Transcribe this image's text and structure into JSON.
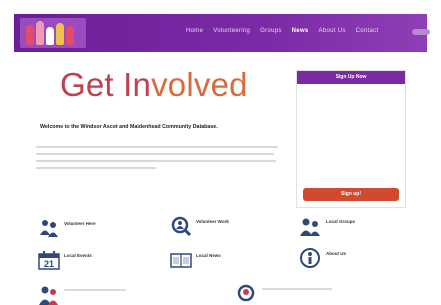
{
  "header": {
    "nav": [
      {
        "label": "Home",
        "active": false
      },
      {
        "label": "Volunteering",
        "active": false
      },
      {
        "label": "Groups",
        "active": false
      },
      {
        "label": "News",
        "active": true
      },
      {
        "label": "About Us",
        "active": false
      },
      {
        "label": "Contact",
        "active": false
      }
    ]
  },
  "main": {
    "title": "Get Involved",
    "welcome": "Welcome to the Windsor Ascot and Maidenhead Community Database."
  },
  "signup": {
    "header": "Sign Up Now",
    "button": "Sign up!"
  },
  "tiles": {
    "volunteer_here": "Volunteer Here",
    "volunteer_work": "Volunteer Work",
    "local_groups": "Local Groups",
    "local_events": "Local Events",
    "calendar_day": "21",
    "local_news": "Local News",
    "about_us": "About Us"
  },
  "colors": {
    "brand_purple": "#7b2aa6",
    "title_red": "#c0404f",
    "button_orange": "#d04a32"
  }
}
